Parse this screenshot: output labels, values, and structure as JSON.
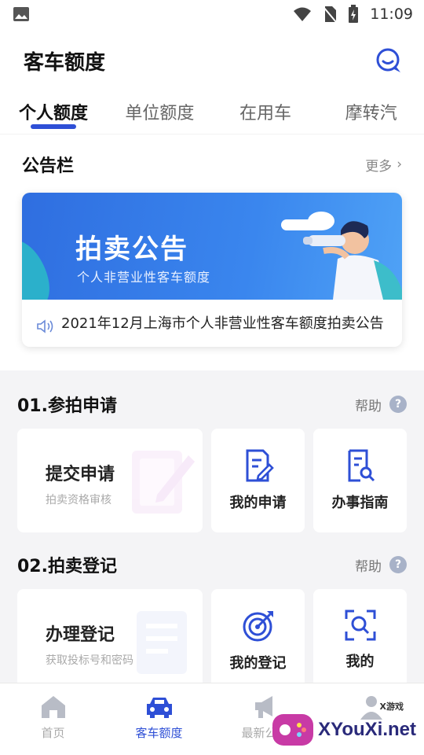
{
  "status_bar": {
    "time": "11:09"
  },
  "header": {
    "title": "客车额度"
  },
  "tabs": [
    {
      "label": "个人额度",
      "active": true
    },
    {
      "label": "单位额度",
      "active": false
    },
    {
      "label": "在用车",
      "active": false
    },
    {
      "label": "摩转汽",
      "active": false
    }
  ],
  "notice_board": {
    "title": "公告栏",
    "more_label": "更多",
    "banner_title": "拍卖公告",
    "banner_subtitle": "个人非营业性客车额度",
    "notice_text": "2021年12月上海市个人非营业性客车额度拍卖公告"
  },
  "section1": {
    "title": "01.参拍申请",
    "help_label": "帮助",
    "big_card": {
      "title": "提交申请",
      "subtitle": "拍卖资格审核"
    },
    "cards": [
      {
        "label": "我的申请",
        "icon": "edit-document-icon"
      },
      {
        "label": "办事指南",
        "icon": "search-document-icon"
      }
    ]
  },
  "section2": {
    "title": "02.拍卖登记",
    "help_label": "帮助",
    "big_card": {
      "title": "办理登记",
      "subtitle": "获取投标号和密码"
    },
    "cards": [
      {
        "label": "我的登记",
        "icon": "target-icon"
      },
      {
        "label": "我的",
        "icon": "scan-search-icon"
      }
    ]
  },
  "tabbar": [
    {
      "label": "首页",
      "icon": "home-icon",
      "active": false
    },
    {
      "label": "客车额度",
      "icon": "car-icon",
      "active": true
    },
    {
      "label": "最新公告",
      "icon": "megaphone-icon",
      "active": false
    },
    {
      "label": "",
      "icon": "user-icon",
      "active": false
    }
  ],
  "watermark": {
    "text": "XYouXi.net",
    "small": "X游戏"
  },
  "colors": {
    "accent": "#2e4fd6",
    "banner": "#3a7fe9"
  }
}
